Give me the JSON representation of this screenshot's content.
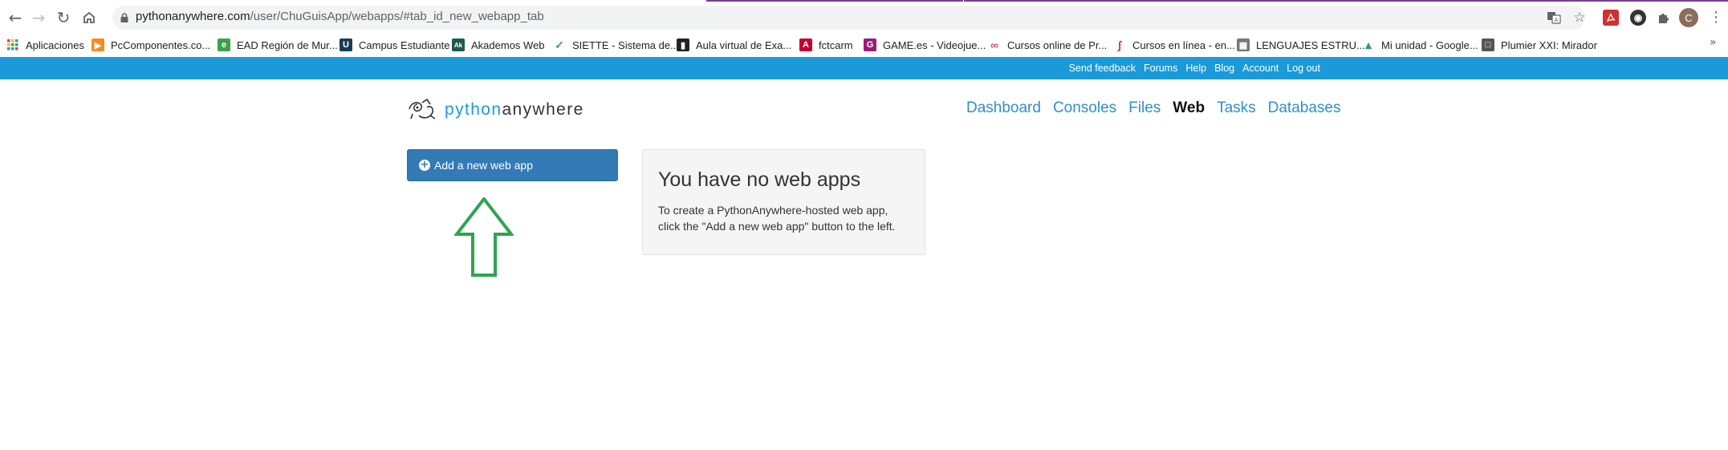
{
  "browser": {
    "url_domain": "pythonanywhere.com",
    "url_path": "/user/ChuGuisApp/webapps/#tab_id_new_webapp_tab",
    "profile_initial": "C",
    "bookmarks": [
      {
        "label": "Aplicaciones",
        "icon": "apps-grid-icon",
        "color": "#1a73e8"
      },
      {
        "label": "PcComponentes.co...",
        "icon": "pccomponentes-icon",
        "color": "#f68b1f"
      },
      {
        "label": "EAD Región de Mur...",
        "icon": "ead-icon",
        "color": "#3aa34a"
      },
      {
        "label": "Campus Estudiante",
        "icon": "campus-icon",
        "color": "#1a3a5a"
      },
      {
        "label": "Akademos Web",
        "icon": "akademos-icon",
        "color": "#1e5a4a"
      },
      {
        "label": "SIETTE - Sistema de...",
        "icon": "siette-check-icon",
        "color": "#3aa34a"
      },
      {
        "label": "Aula virtual de Exa...",
        "icon": "document-icon",
        "color": "#222222"
      },
      {
        "label": "fctcarm",
        "icon": "angular-icon",
        "color": "#c3002f"
      },
      {
        "label": "GAME.es - Videojue...",
        "icon": "game-icon",
        "color": "#9b1b7a"
      },
      {
        "label": "Cursos online de Pr...",
        "icon": "cursos-icon",
        "color": "#e0457b"
      },
      {
        "label": "Cursos en línea - en...",
        "icon": "coursera-icon",
        "color": "#d9363e"
      },
      {
        "label": "LENGUAJES ESTRU...",
        "icon": "building-icon",
        "color": "#777777"
      },
      {
        "label": "Mi unidad - Google...",
        "icon": "google-drive-icon",
        "color": "#1fa463"
      },
      {
        "label": "Plumier XXI: Mirador",
        "icon": "plumier-icon",
        "color": "#555555"
      }
    ]
  },
  "topbar": {
    "links": [
      "Send feedback",
      "Forums",
      "Help",
      "Blog",
      "Account",
      "Log out"
    ]
  },
  "logo": {
    "part1": "python",
    "part2": "anywhere"
  },
  "nav": {
    "items": [
      "Dashboard",
      "Consoles",
      "Files",
      "Web",
      "Tasks",
      "Databases"
    ],
    "active": "Web"
  },
  "main": {
    "add_button_label": "Add a new web app",
    "panel_title": "You have no web apps",
    "panel_text": "To create a PythonAnywhere-hosted web app, click the \"Add a new web app\" button to the left."
  },
  "colors": {
    "brand_blue": "#1a9ad8",
    "button_blue": "#337ab7",
    "arrow_green": "#2ea44f"
  }
}
